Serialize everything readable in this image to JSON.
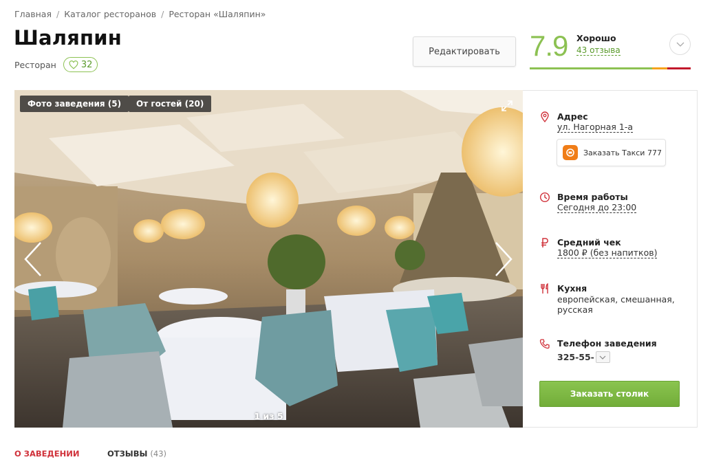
{
  "breadcrumb": [
    "Главная",
    "Каталог ресторанов",
    "Ресторан «Шаляпин»"
  ],
  "venue": {
    "name": "Шаляпин",
    "type": "Ресторан",
    "likes": "32"
  },
  "edit_button": "Редактировать",
  "rating": {
    "score": "7.9",
    "word": "Хорошо",
    "reviews": "43 отзыва",
    "bar_colors": [
      "#8cc152",
      "#f6a21b",
      "#c2182b"
    ]
  },
  "gallery": {
    "tabs": [
      "Фото заведения (5)",
      "От гостей (20)"
    ],
    "counter": "1 из 5"
  },
  "info": {
    "address": {
      "label": "Адрес",
      "value": "ул. Нагорная 1-а"
    },
    "taxi": {
      "label": "Заказать Такси 777"
    },
    "hours": {
      "label": "Время работы",
      "value": "Сегодня до 23:00"
    },
    "check": {
      "label": "Средний чек",
      "value": "1800 ₽ (без напитков)"
    },
    "cuisine": {
      "label": "Кухня",
      "value": "европейская, смешанная, русская"
    },
    "phone": {
      "label": "Телефон заведения",
      "value": "325-55-"
    },
    "book_button": "Заказать столик"
  },
  "bottom_tabs": {
    "about": "О заведении",
    "reviews": "Отзывы",
    "reviews_count": "(43)"
  },
  "colors": {
    "accent_green": "#8cc152",
    "accent_red": "#d0323b",
    "taxi_orange": "#f07d17"
  }
}
